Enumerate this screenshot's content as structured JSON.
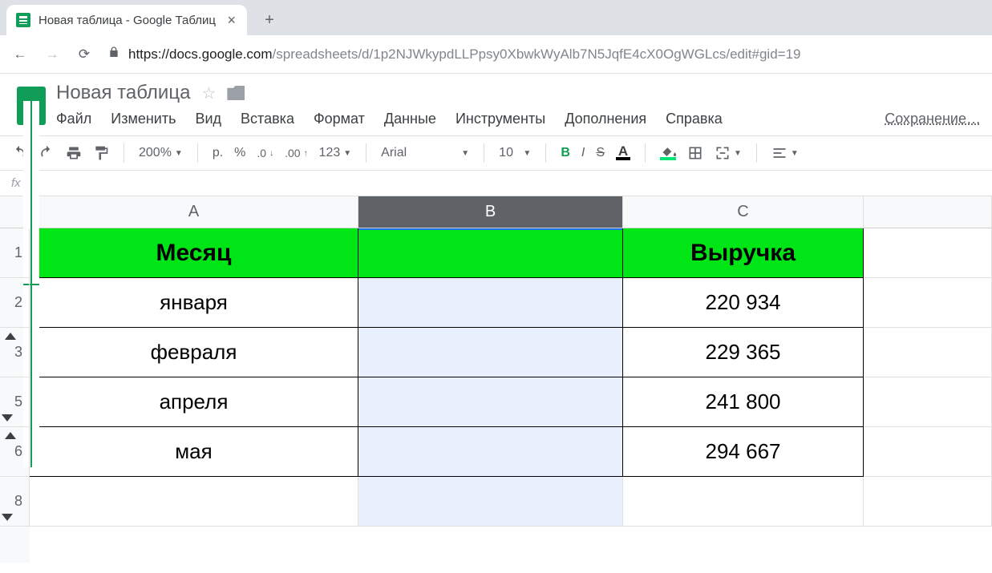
{
  "browser": {
    "tab_title": "Новая таблица - Google Таблиц",
    "url_host": "https://docs.google.com",
    "url_path": "/spreadsheets/d/1p2NJWkypdLLPpsy0XbwkWyAlb7N5JqfE4cX0OgWGLcs/edit#gid=19"
  },
  "header": {
    "doc_title": "Новая таблица",
    "saving": "Сохранение…"
  },
  "menu": {
    "file": "Файл",
    "edit": "Изменить",
    "view": "Вид",
    "insert": "Вставка",
    "format": "Формат",
    "data": "Данные",
    "tools": "Инструменты",
    "addons": "Дополнения",
    "help": "Справка"
  },
  "toolbar": {
    "zoom": "200%",
    "currency": "р.",
    "percent": "%",
    "dec_dec": ".0",
    "dec_inc": ".00",
    "num123": "123",
    "font": "Arial",
    "font_size": "10",
    "bold": "B",
    "italic": "I",
    "strike": "S",
    "textcolor": "A"
  },
  "fx": {
    "label": "fx"
  },
  "columns": {
    "A": "A",
    "B": "B",
    "C": "C"
  },
  "rows": {
    "r1": "1",
    "r2": "2",
    "r3": "3",
    "r5": "5",
    "r6": "6",
    "r8": "8"
  },
  "table": {
    "header": {
      "month": "Месяц",
      "blank": "",
      "revenue": "Выручка"
    },
    "data": [
      {
        "month": "января",
        "b": "",
        "revenue": "220 934"
      },
      {
        "month": "февраля",
        "b": "",
        "revenue": "229 365"
      },
      {
        "month": "апреля",
        "b": "",
        "revenue": "241 800"
      },
      {
        "month": "мая",
        "b": "",
        "revenue": "294 667"
      }
    ]
  }
}
